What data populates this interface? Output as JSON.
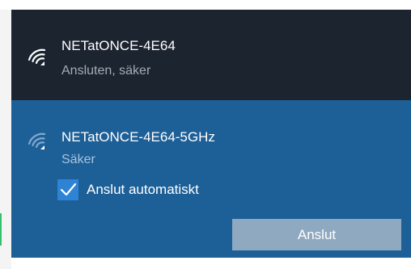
{
  "networks": [
    {
      "name": "NETatONCE-4E64",
      "status": "Ansluten, säker",
      "icon": "wifi-signal-icon"
    },
    {
      "name": "NETatONCE-4E64-5GHz",
      "status": "Säker",
      "icon": "wifi-signal-icon"
    }
  ],
  "auto_connect": {
    "label": "Anslut automatiskt",
    "checked": true
  },
  "connect_button": {
    "label": "Anslut"
  },
  "colors": {
    "connected_bg": "#1c2430",
    "selected_bg": "#1d5f97",
    "checkbox_bg": "#2e83d4",
    "button_bg": "#8fa9c1"
  }
}
